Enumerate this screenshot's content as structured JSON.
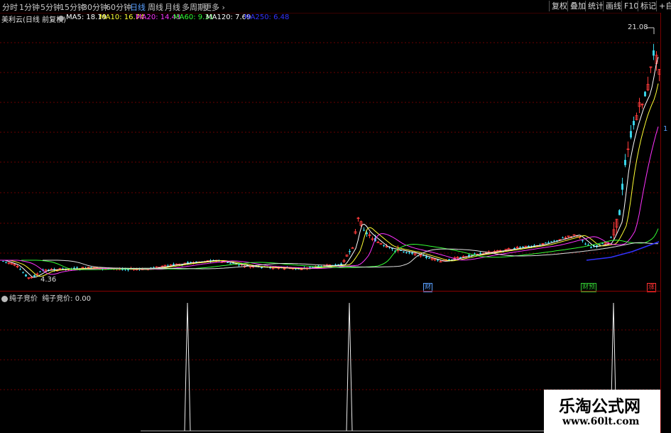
{
  "toolbar": {
    "timeframes": [
      "分时",
      "1分钟",
      "5分钟",
      "15分钟",
      "30分钟",
      "60分钟",
      "日线",
      "周线",
      "月线",
      "多周期",
      "更多"
    ],
    "active": "日线",
    "right_buttons": [
      "复权",
      "叠加",
      "统计",
      "画线",
      "F10",
      "标记",
      "+自"
    ]
  },
  "stock": {
    "title": "美利云(日线 前复权)",
    "ma": [
      {
        "label": "MA5: 18.19",
        "color": "#ffffff"
      },
      {
        "label": "MA10: 16.74",
        "color": "#ffff33"
      },
      {
        "label": "MA20: 14.43",
        "color": "#ff33ff"
      },
      {
        "label": "MA60: 9.31",
        "color": "#33ff33"
      },
      {
        "label": "MA120: 7.69",
        "color": "#ffffff"
      },
      {
        "label": "MA250: 6.48",
        "color": "#3333ff"
      }
    ]
  },
  "price_labels": {
    "high": "21.08",
    "low": "4.36"
  },
  "event_tags": [
    {
      "text": "财",
      "color": "#5aa0ff"
    },
    {
      "text": "财预",
      "color": "#33cc33"
    },
    {
      "text": "涨",
      "color": "#ff3333"
    }
  ],
  "right_marker": "1",
  "indicator": {
    "title": "纯子竞价",
    "value_label": "纯子竞价: 0.00"
  },
  "watermark": {
    "title": "乐淘公式网",
    "url": "www.60lt.com"
  }
}
